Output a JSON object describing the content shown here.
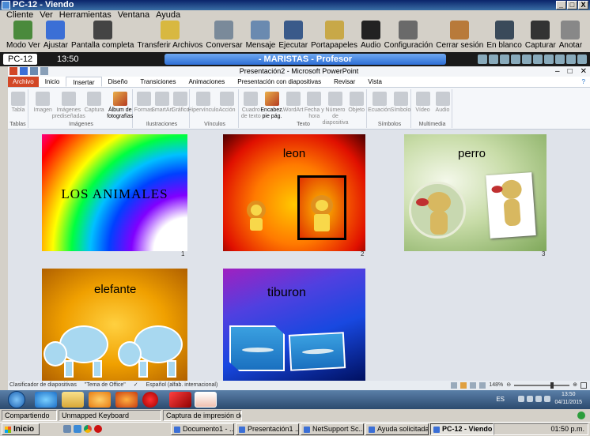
{
  "netsupport": {
    "title": "PC-12 - Viendo",
    "window_buttons": [
      "_",
      "□",
      "X"
    ],
    "menu": [
      "Cliente",
      "Ver",
      "Herramientas",
      "Ventana",
      "Ayuda"
    ],
    "toolbar": [
      {
        "label": "Modo Ver",
        "icon": "view-mode-icon",
        "color": "#4a8a3c"
      },
      {
        "label": "Ajustar",
        "icon": "fit-icon",
        "color": "#3b6fd6"
      },
      {
        "label": "Pantalla completa",
        "icon": "fullscreen-icon",
        "color": "#444444"
      },
      {
        "label": "Transferir Archivos",
        "icon": "file-transfer-icon",
        "color": "#d8b840"
      },
      {
        "label": "Conversar",
        "icon": "chat-icon",
        "color": "#7a8a9a"
      },
      {
        "label": "Mensaje",
        "icon": "message-icon",
        "color": "#6a8ab0"
      },
      {
        "label": "Ejecutar",
        "icon": "execute-icon",
        "color": "#3a5a8a"
      },
      {
        "label": "Portapapeles",
        "icon": "clipboard-icon",
        "color": "#c8a848"
      },
      {
        "label": "Audio",
        "icon": "microphone-icon",
        "color": "#222222"
      },
      {
        "label": "Configuración",
        "icon": "settings-icon",
        "color": "#6a6a6a"
      },
      {
        "label": "Cerrar sesión",
        "icon": "logoff-icon",
        "color": "#b87a3a"
      },
      {
        "label": "En blanco",
        "icon": "blank-screen-icon",
        "color": "#3a4a5a"
      },
      {
        "label": "Capturar",
        "icon": "camera-icon",
        "color": "#333333"
      },
      {
        "label": "Anotar",
        "icon": "annotate-icon",
        "color": "#888888"
      }
    ],
    "status_pc": "PC-12",
    "status_time": "13:50",
    "status_banner": "- MARISTAS - Profesor"
  },
  "ppt": {
    "window_title": "Presentación2 - Microsoft PowerPoint",
    "window_buttons": [
      "–",
      "□",
      "✕"
    ],
    "tabs": [
      "Archivo",
      "Inicio",
      "Insertar",
      "Diseño",
      "Transiciones",
      "Animaciones",
      "Presentación con diapositivas",
      "Revisar",
      "Vista"
    ],
    "selected_tab": "Insertar",
    "ribbon_groups": [
      {
        "label": "Tablas",
        "buttons": [
          "Tabla"
        ]
      },
      {
        "label": "Imágenes",
        "buttons": [
          "Imagen",
          "Imágenes prediseñadas",
          "Captura",
          "Álbum de fotografías"
        ]
      },
      {
        "label": "Ilustraciones",
        "buttons": [
          "Formas",
          "SmartArt",
          "Gráfico"
        ]
      },
      {
        "label": "Vínculos",
        "buttons": [
          "Hipervínculo",
          "Acción"
        ]
      },
      {
        "label": "Texto",
        "buttons": [
          "Cuadro de texto",
          "Encabez. pie pág.",
          "WordArt",
          "Fecha y hora",
          "Número de diapositiva",
          "Objeto"
        ]
      },
      {
        "label": "Símbolos",
        "buttons": [
          "Ecuación",
          "Símbolo"
        ]
      },
      {
        "label": "Multimedia",
        "buttons": [
          "Vídeo",
          "Audio"
        ]
      }
    ],
    "slides": [
      {
        "number": "1",
        "text": "LOS ANIMALES"
      },
      {
        "number": "2",
        "text": "leon"
      },
      {
        "number": "3",
        "text": "perro"
      },
      {
        "number": "",
        "text": "elefante"
      },
      {
        "number": "",
        "text": "tiburon"
      }
    ],
    "status": {
      "view": "Clasificador de diapositivas",
      "theme": "\"Tema de Office\"",
      "language": "Español (alfab. internacional)",
      "zoom": "148%"
    }
  },
  "win7taskbar": {
    "lang": "ES",
    "time": "13:50",
    "date": "04/11/2015"
  },
  "ns_bottom": {
    "cells": [
      "Compartiendo",
      "Unmapped Keyboard",
      "Captura de impresión des..."
    ]
  },
  "xp_taskbar": {
    "start": "Inicio",
    "buttons": [
      "Documento1 - ...",
      "Presentación1 ...",
      "NetSupport Sc...",
      "Ayuda solicitada",
      "PC-12 - Viendo"
    ],
    "active": "PC-12 - Viendo",
    "tray_time": "01:50 p.m."
  }
}
